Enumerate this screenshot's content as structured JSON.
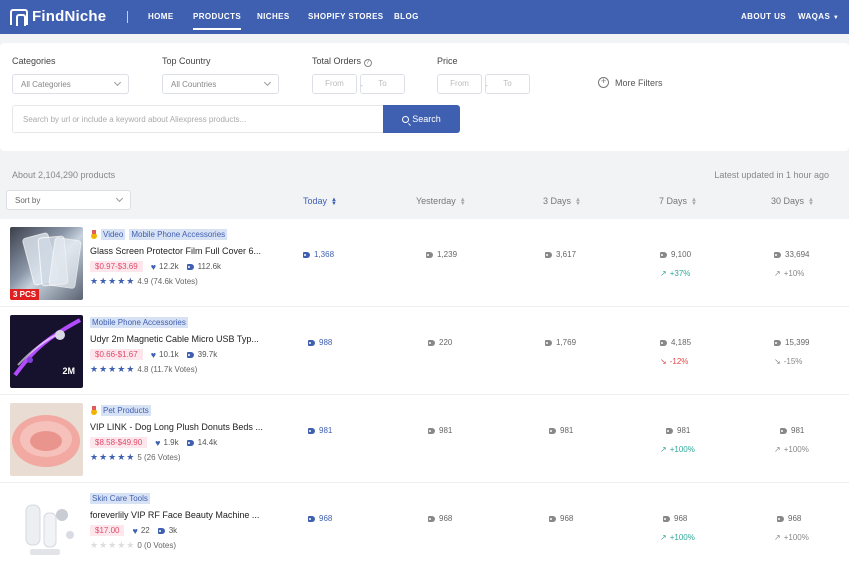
{
  "nav": {
    "logo": "FindNiche",
    "links": [
      "HOME",
      "PRODUCTS",
      "NICHES",
      "SHOPIFY STORES",
      "BLOG"
    ],
    "about": "ABOUT US",
    "user": "WAQAS"
  },
  "filters": {
    "categories_label": "Categories",
    "categories_value": "All Categories",
    "country_label": "Top Country",
    "country_value": "All Countries",
    "orders_label": "Total Orders",
    "price_label": "Price",
    "from": "From",
    "to": "To",
    "more": "More Filters",
    "search_placeholder": "Search by url or include a keyword about Aliexpress products...",
    "search_button": "Search"
  },
  "results": {
    "count": "About 2,104,290 products",
    "updated": "Latest updated in 1 hour ago",
    "sort_by": "Sort by",
    "columns": [
      "Today",
      "Yesterday",
      "3 Days",
      "7 Days",
      "30 Days"
    ]
  },
  "products": [
    {
      "video": "Video",
      "category": "Mobile Phone Accessories",
      "title": "Glass Screen Protector Film Full Cover 6...",
      "price": "$0.97-$3.69",
      "likes": "12.2k",
      "orders": "112.6k",
      "rating": 4.9,
      "rating_text": "4.9 (74.6k Votes)",
      "thumb_label": "3 PCS",
      "today": "1,368",
      "yesterday": "1,239",
      "three_days": "3,617",
      "seven_days": "9,100",
      "thirty_days": "33,694",
      "trend7": "+37%",
      "trend30": "+10%"
    },
    {
      "category": "Mobile Phone Accessories",
      "title": "Udyr 2m Magnetic Cable Micro USB Typ...",
      "price": "$0.66-$1.67",
      "likes": "10.1k",
      "orders": "39.7k",
      "rating": 4.8,
      "rating_text": "4.8 (11.7k Votes)",
      "thumb_label": "2M",
      "today": "988",
      "yesterday": "220",
      "three_days": "1,769",
      "seven_days": "4,185",
      "thirty_days": "15,399",
      "trend7": "-12%",
      "trend30": "-15%"
    },
    {
      "category": "Pet Products",
      "title": "VIP LINK - Dog Long Plush Donuts Beds ...",
      "price": "$8.58-$49.90",
      "likes": "1.9k",
      "orders": "14.4k",
      "rating": 5,
      "rating_text": "5 (26 Votes)",
      "today": "981",
      "yesterday": "981",
      "three_days": "981",
      "seven_days": "981",
      "thirty_days": "981",
      "trend7": "+100%",
      "trend30": "+100%"
    },
    {
      "category": "Skin Care Tools",
      "title": "foreverlily VIP RF Face Beauty Machine ...",
      "price": "$17.00",
      "likes": "22",
      "orders": "3k",
      "rating": 0,
      "rating_text": "0 (0 Votes)",
      "today": "968",
      "yesterday": "968",
      "three_days": "968",
      "seven_days": "968",
      "thirty_days": "968",
      "trend7": "+100%",
      "trend30": "+100%"
    }
  ],
  "colors": {
    "brand": "#3f5fb0",
    "price": "#e24a6a",
    "trend_up": "#2fa89a",
    "trend_down": "#e04848"
  }
}
